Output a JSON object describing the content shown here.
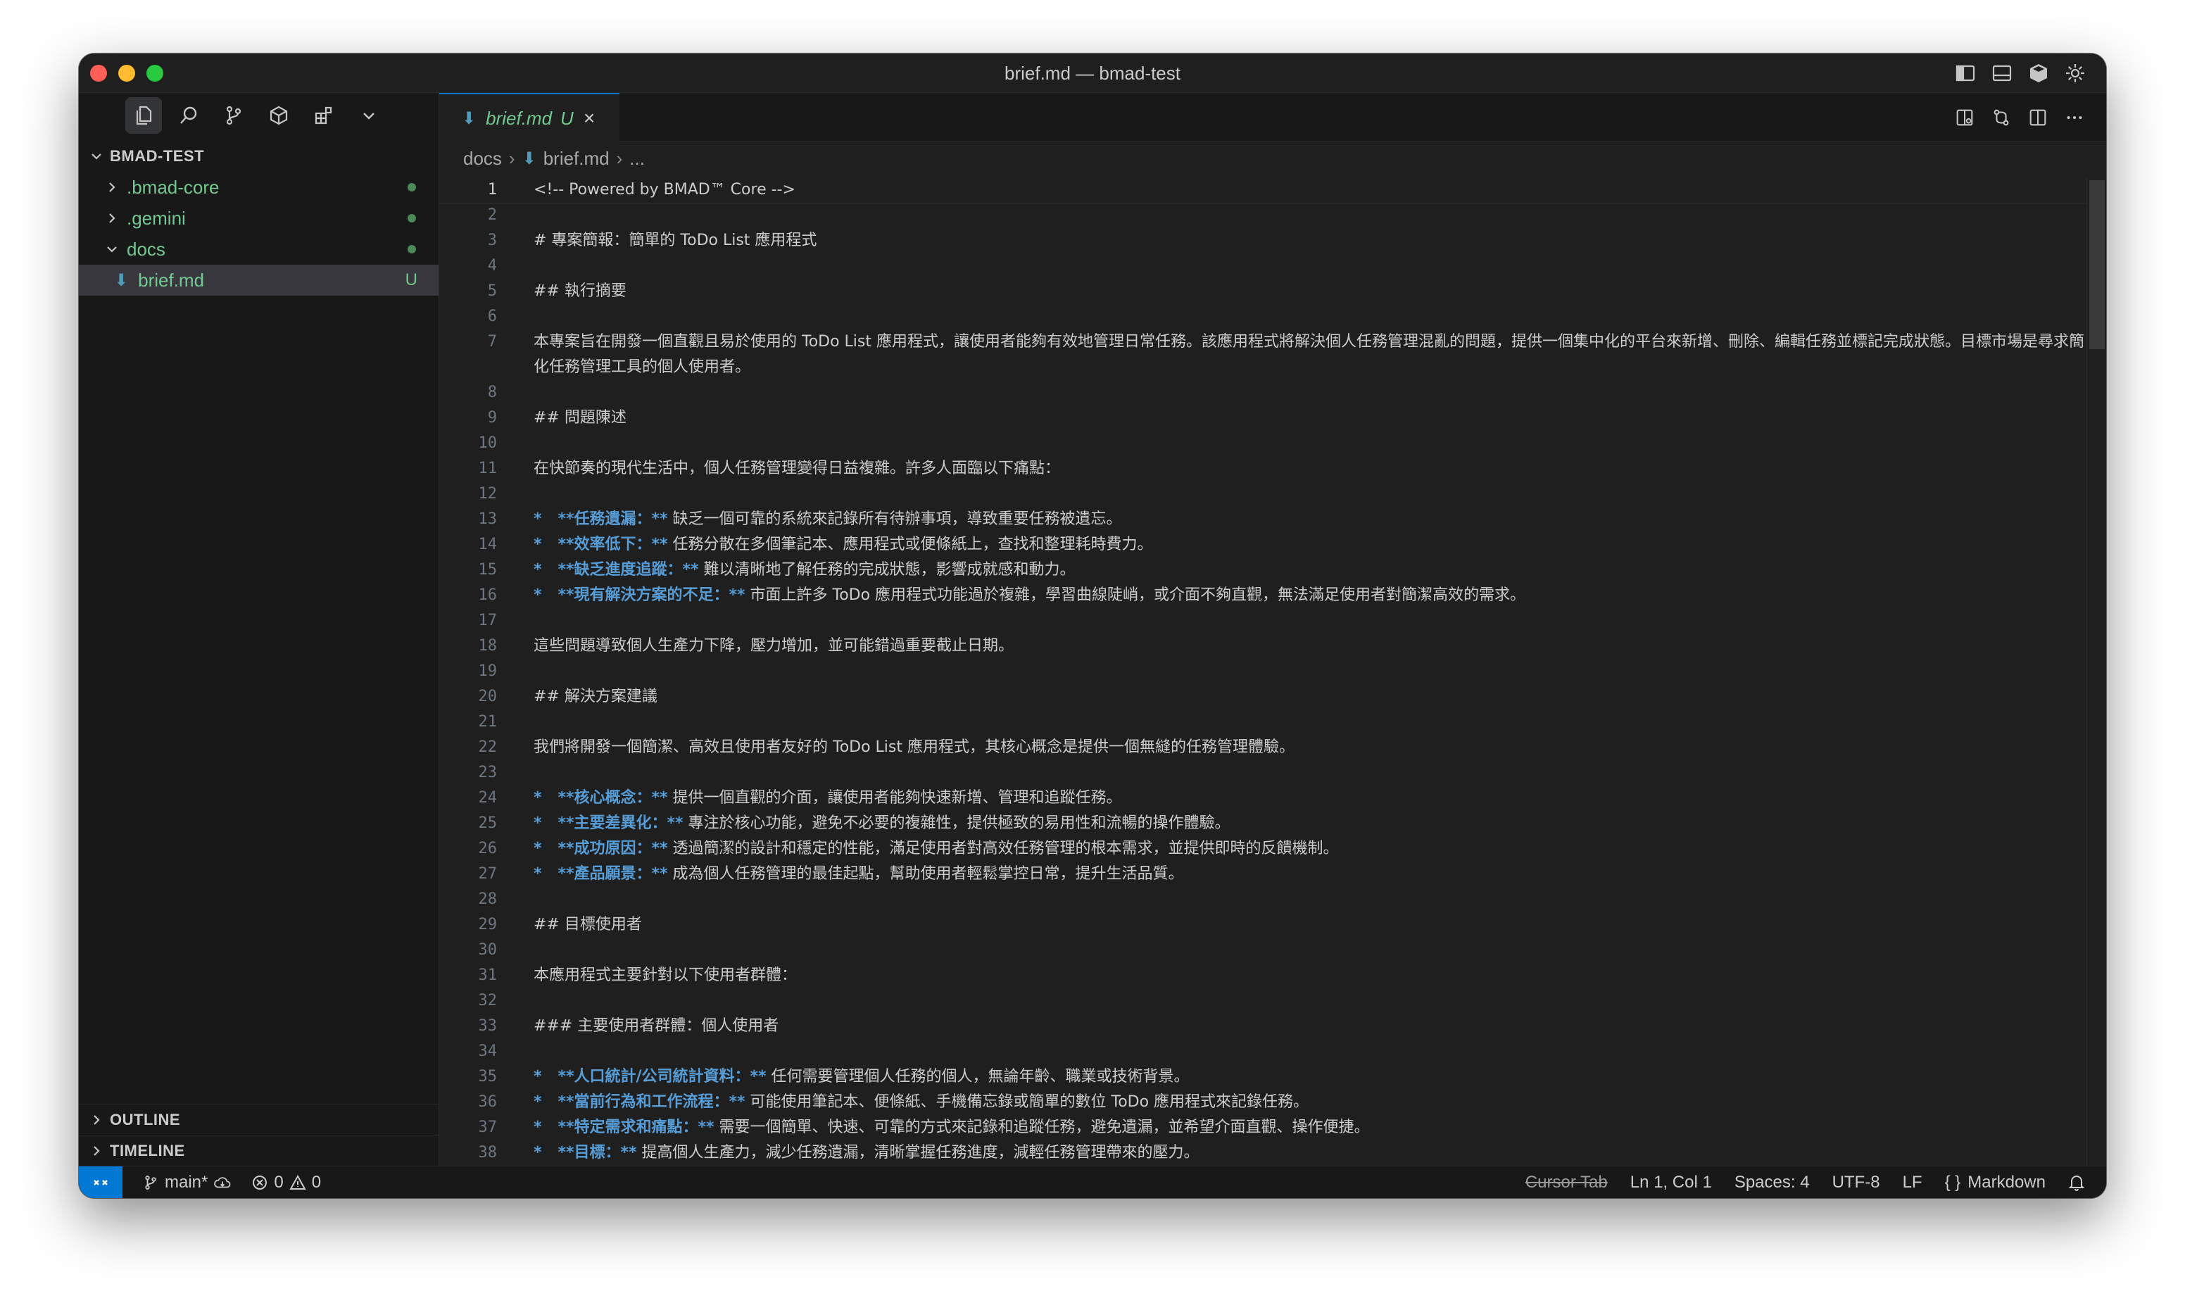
{
  "window": {
    "title": "brief.md — bmad-test"
  },
  "explorer": {
    "root": "BMAD-TEST",
    "items": [
      {
        "label": ".bmad-core",
        "type": "folder"
      },
      {
        "label": ".gemini",
        "type": "folder"
      },
      {
        "label": "docs",
        "type": "folder-open"
      },
      {
        "label": "brief.md",
        "type": "file",
        "badge": "U"
      }
    ],
    "panels": [
      "OUTLINE",
      "TIMELINE"
    ]
  },
  "tab": {
    "label": "brief.md",
    "badge": "U"
  },
  "breadcrumb": [
    "docs",
    "brief.md",
    "..."
  ],
  "lines": [
    {
      "n": "1",
      "parts": [
        {
          "t": "<!-- Powered by BMAD™ Core -->",
          "c": "comment"
        }
      ]
    },
    {
      "n": "2",
      "parts": []
    },
    {
      "n": "3",
      "parts": [
        {
          "t": "# 專案簡報：簡單的 ToDo List 應用程式",
          "c": "heading"
        }
      ]
    },
    {
      "n": "4",
      "parts": []
    },
    {
      "n": "5",
      "parts": [
        {
          "t": "## 執行摘要",
          "c": "heading"
        }
      ]
    },
    {
      "n": "6",
      "parts": []
    },
    {
      "n": "7",
      "parts": [
        {
          "t": "本專案旨在開發一個直觀且易於使用的 ToDo List 應用程式，讓使用者能夠有效地管理日常任務。該應用程式將解決個人任務管理混亂的問題，提供一個集中化的平台來新增、刪除、編輯任務並標記完成狀態。目標市場是尋求簡化任務管理工具的個人使用者。",
          "c": ""
        }
      ]
    },
    {
      "n": "8",
      "parts": []
    },
    {
      "n": "9",
      "parts": [
        {
          "t": "## 問題陳述",
          "c": "heading"
        }
      ]
    },
    {
      "n": "10",
      "parts": []
    },
    {
      "n": "11",
      "parts": [
        {
          "t": "在快節奏的現代生活中，個人任務管理變得日益複雜。許多人面臨以下痛點：",
          "c": ""
        }
      ]
    },
    {
      "n": "12",
      "parts": []
    },
    {
      "n": "13",
      "parts": [
        {
          "t": "*   **任務遺漏：**",
          "c": "mk"
        },
        {
          "t": " 缺乏一個可靠的系統來記錄所有待辦事項，導致重要任務被遺忘。",
          "c": ""
        }
      ]
    },
    {
      "n": "14",
      "parts": [
        {
          "t": "*   **效率低下：**",
          "c": "mk"
        },
        {
          "t": " 任務分散在多個筆記本、應用程式或便條紙上，查找和整理耗時費力。",
          "c": ""
        }
      ]
    },
    {
      "n": "15",
      "parts": [
        {
          "t": "*   **缺乏進度追蹤：**",
          "c": "mk"
        },
        {
          "t": " 難以清晰地了解任務的完成狀態，影響成就感和動力。",
          "c": ""
        }
      ]
    },
    {
      "n": "16",
      "parts": [
        {
          "t": "*   **現有解決方案的不足：**",
          "c": "mk"
        },
        {
          "t": " 市面上許多 ToDo 應用程式功能過於複雜，學習曲線陡峭，或介面不夠直觀，無法滿足使用者對簡潔高效的需求。",
          "c": ""
        }
      ]
    },
    {
      "n": "17",
      "parts": []
    },
    {
      "n": "18",
      "parts": [
        {
          "t": "這些問題導致個人生產力下降，壓力增加，並可能錯過重要截止日期。",
          "c": ""
        }
      ]
    },
    {
      "n": "19",
      "parts": []
    },
    {
      "n": "20",
      "parts": [
        {
          "t": "## 解決方案建議",
          "c": "heading"
        }
      ]
    },
    {
      "n": "21",
      "parts": []
    },
    {
      "n": "22",
      "parts": [
        {
          "t": "我們將開發一個簡潔、高效且使用者友好的 ToDo List 應用程式，其核心概念是提供一個無縫的任務管理體驗。",
          "c": ""
        }
      ]
    },
    {
      "n": "23",
      "parts": []
    },
    {
      "n": "24",
      "parts": [
        {
          "t": "*   **核心概念：**",
          "c": "mk"
        },
        {
          "t": " 提供一個直觀的介面，讓使用者能夠快速新增、管理和追蹤任務。",
          "c": ""
        }
      ]
    },
    {
      "n": "25",
      "parts": [
        {
          "t": "*   **主要差異化：**",
          "c": "mk"
        },
        {
          "t": " 專注於核心功能，避免不必要的複雜性，提供極致的易用性和流暢的操作體驗。",
          "c": ""
        }
      ]
    },
    {
      "n": "26",
      "parts": [
        {
          "t": "*   **成功原因：**",
          "c": "mk"
        },
        {
          "t": " 透過簡潔的設計和穩定的性能，滿足使用者對高效任務管理的根本需求，並提供即時的反饋機制。",
          "c": ""
        }
      ]
    },
    {
      "n": "27",
      "parts": [
        {
          "t": "*   **產品願景：**",
          "c": "mk"
        },
        {
          "t": " 成為個人任務管理的最佳起點，幫助使用者輕鬆掌控日常，提升生活品質。",
          "c": ""
        }
      ]
    },
    {
      "n": "28",
      "parts": []
    },
    {
      "n": "29",
      "parts": [
        {
          "t": "## 目標使用者",
          "c": "heading"
        }
      ]
    },
    {
      "n": "30",
      "parts": []
    },
    {
      "n": "31",
      "parts": [
        {
          "t": "本應用程式主要針對以下使用者群體：",
          "c": ""
        }
      ]
    },
    {
      "n": "32",
      "parts": []
    },
    {
      "n": "33",
      "parts": [
        {
          "t": "### 主要使用者群體：個人使用者",
          "c": "heading"
        }
      ]
    },
    {
      "n": "34",
      "parts": []
    },
    {
      "n": "35",
      "parts": [
        {
          "t": "*   **人口統計/公司統計資料：**",
          "c": "mk"
        },
        {
          "t": " 任何需要管理個人任務的個人，無論年齡、職業或技術背景。",
          "c": ""
        }
      ]
    },
    {
      "n": "36",
      "parts": [
        {
          "t": "*   **當前行為和工作流程：**",
          "c": "mk"
        },
        {
          "t": " 可能使用筆記本、便條紙、手機備忘錄或簡單的數位 ToDo 應用程式來記錄任務。",
          "c": ""
        }
      ]
    },
    {
      "n": "37",
      "parts": [
        {
          "t": "*   **特定需求和痛點：**",
          "c": "mk"
        },
        {
          "t": " 需要一個簡單、快速、可靠的方式來記錄和追蹤任務，避免遺漏，並希望介面直觀、操作便捷。",
          "c": ""
        }
      ]
    },
    {
      "n": "38",
      "parts": [
        {
          "t": "*   **目標：**",
          "c": "mk"
        },
        {
          "t": " 提高個人生產力，減少任務遺漏，清晰掌握任務進度，減輕任務管理帶來的壓力。",
          "c": ""
        }
      ]
    }
  ],
  "status": {
    "branch": "main*",
    "errors": "0",
    "warnings": "0",
    "cursor_tab": "Cursor Tab",
    "position": "Ln 1, Col 1",
    "spaces": "Spaces: 4",
    "encoding": "UTF-8",
    "eol": "LF",
    "language": "Markdown"
  },
  "colors": {
    "accent": "#0078d4",
    "git_untracked": "#73c991",
    "heading": "#569cd6",
    "comment": "#6a9955"
  }
}
